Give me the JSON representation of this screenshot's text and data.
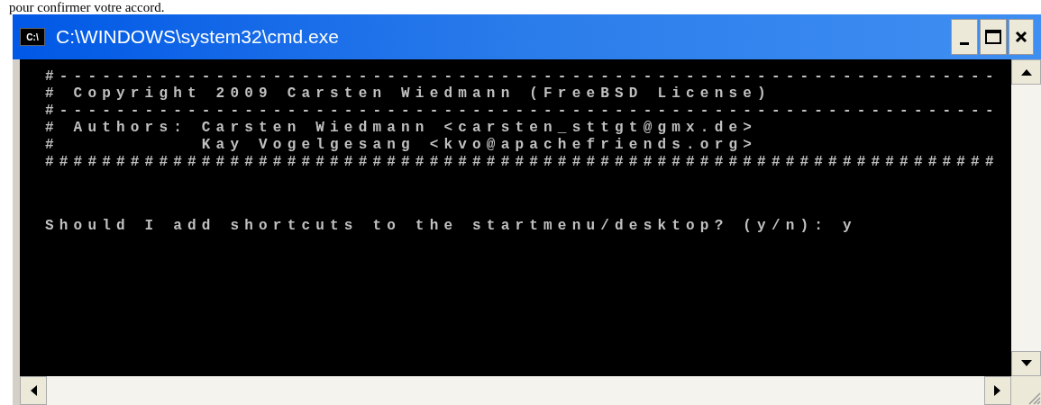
{
  "page_text": "pour confirmer votre accord.",
  "window": {
    "title": "C:\\WINDOWS\\system32\\cmd.exe",
    "icon_text": "C:\\"
  },
  "console": {
    "lines": [
      {
        "kind": "output",
        "text": "#------------------------------------------------------------------"
      },
      {
        "kind": "output",
        "text": "# Copyright 2009 Carsten Wiedmann (FreeBSD License)"
      },
      {
        "kind": "output",
        "text": "#------------------------------------------------------------------"
      },
      {
        "kind": "output",
        "text": "# Authors: Carsten Wiedmann <carsten_sttgt@gmx.de>"
      },
      {
        "kind": "output",
        "text": "#          Kay Vogelgesang <kvo@apachefriends.org>"
      },
      {
        "kind": "output",
        "text": "###################################################################"
      },
      {
        "kind": "prompt",
        "text": "Should I add shortcuts to the startmenu/desktop? (y/n): y"
      }
    ]
  }
}
